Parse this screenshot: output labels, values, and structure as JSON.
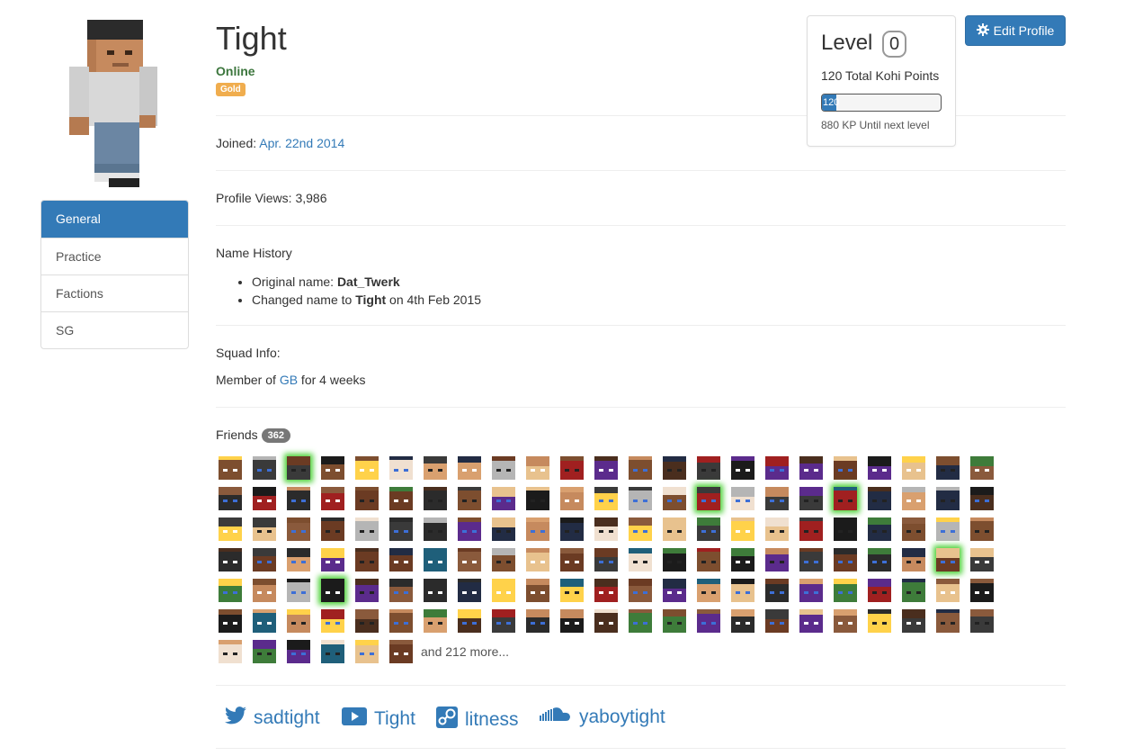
{
  "profile": {
    "username": "Tight",
    "status": "Online",
    "rank": "Gold",
    "joined_label": "Joined:",
    "joined_date": "Apr. 22nd 2014",
    "views_label": "Profile Views: 3,986",
    "name_history_label": "Name History",
    "original_prefix": "Original name: ",
    "original_name": "Dat_Twerk",
    "changed_prefix": "Changed name to ",
    "changed_name": "Tight",
    "changed_suffix": " on 4th Feb 2015",
    "squad_label": "Squad Info:",
    "squad_prefix": "Member of ",
    "squad_name": "GB",
    "squad_suffix": " for 4 weeks",
    "friends_label": "Friends",
    "friends_count": "362",
    "more_friends": "and 212 more..."
  },
  "sidebar": {
    "items": [
      {
        "label": "General"
      },
      {
        "label": "Practice"
      },
      {
        "label": "Factions"
      },
      {
        "label": "SG"
      }
    ]
  },
  "level": {
    "title": "Level",
    "value": "0",
    "points": "120 Total Kohi Points",
    "bar_text": "120",
    "progress_fraction": 0.12,
    "next": "880 KP Until next level"
  },
  "edit_button": {
    "label": "Edit Profile"
  },
  "social": [
    {
      "icon": "twitter-icon",
      "label": "sadtight"
    },
    {
      "icon": "youtube-icon",
      "label": "Tight"
    },
    {
      "icon": "steam-icon",
      "label": "litness"
    },
    {
      "icon": "soundcloud-icon",
      "label": "yaboytight"
    }
  ],
  "colors": {
    "primary": "#337ab7",
    "online": "#3c763d",
    "gold": "#f0ad4e",
    "friend_glow": "#4cd137"
  }
}
